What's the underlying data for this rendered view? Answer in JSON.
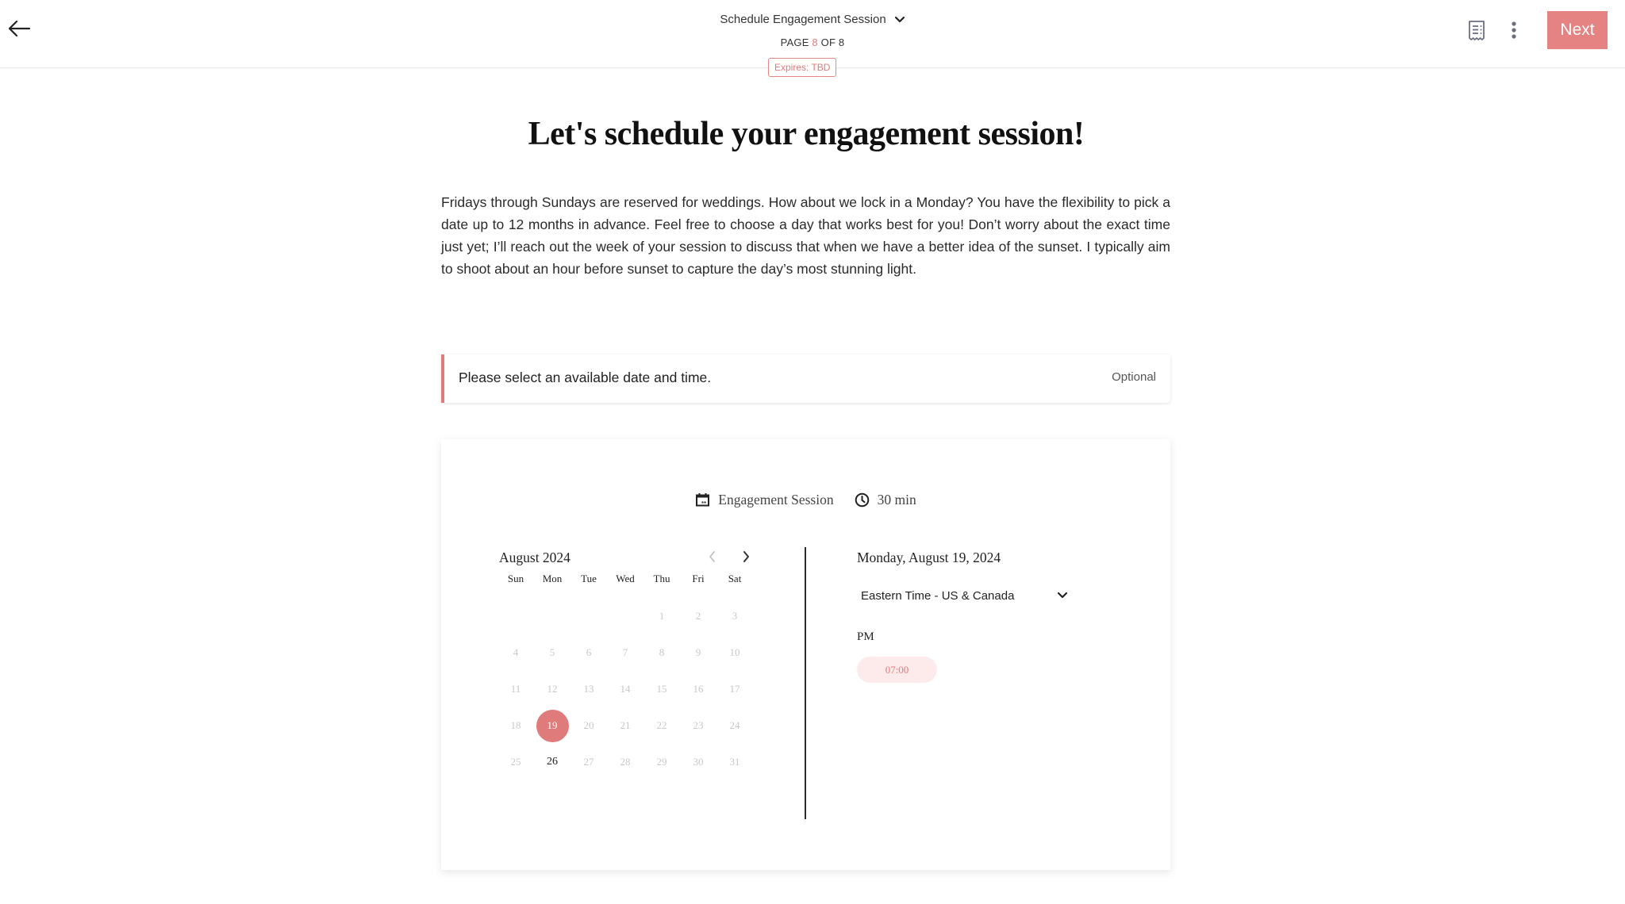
{
  "header": {
    "back_icon": "arrow-left-icon",
    "title": "Schedule Engagement Session",
    "title_chevron_icon": "chevron-down-icon",
    "page_label": "PAGE",
    "page_current": "8",
    "page_of": "OF 8",
    "expires": "Expires: TBD",
    "receipt_icon": "receipt-icon",
    "more_icon": "more-vertical-icon",
    "next_label": "Next",
    "accent_color": "#e58383"
  },
  "content": {
    "heading": "Let's schedule your engagement session!",
    "intro": "Fridays through Sundays are reserved for weddings. How about we lock in a Monday? You have the flexibility to pick a date up to 12 months in advance. Feel free to choose a day that works best for you! Don’t worry about the exact time just yet; I’ll reach out the week of your session to discuss that when we have a better idea of the sunset. I typically aim to shoot about an hour before sunset to capture the day’s most stunning light."
  },
  "question": {
    "text": "Please select an available date and time.",
    "optional_label": "Optional"
  },
  "scheduler": {
    "event_icon": "calendar-icon",
    "event_name": "Engagement Session",
    "duration_icon": "clock-icon",
    "duration": "30 min",
    "month_label": "August 2024",
    "prev_icon": "chevron-left-icon",
    "next_icon": "chevron-right-icon",
    "weekdays": [
      "Sun",
      "Mon",
      "Tue",
      "Wed",
      "Thu",
      "Fri",
      "Sat"
    ],
    "leading_blank_days": 4,
    "days_in_month": 31,
    "selected_day": 19,
    "available_days": [
      26
    ],
    "selected_date_label": "Monday, August 19, 2024",
    "timezone": "Eastern Time - US & Canada",
    "timezone_icon": "chevron-down-icon",
    "period_label": "PM",
    "time_slots": [
      "07:00"
    ]
  }
}
